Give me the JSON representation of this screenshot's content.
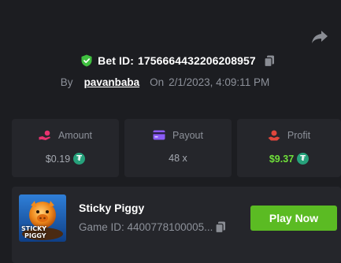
{
  "share": {
    "icon": "share-icon"
  },
  "bet": {
    "label": "Bet ID:",
    "id": "1756664432206208957",
    "by_label": "By",
    "username": "pavanbaba",
    "on_label": "On",
    "datetime": "2/1/2023, 4:09:11 PM"
  },
  "stats": {
    "amount": {
      "label": "Amount",
      "value": "$0.19",
      "icon": "hand-coin-icon",
      "icon_color": "#e8336f"
    },
    "payout": {
      "label": "Payout",
      "value": "48 x",
      "icon": "credit-card-icon",
      "icon_color": "#8b5cf6"
    },
    "profit": {
      "label": "Profit",
      "value": "$9.37",
      "icon": "money-hand-icon",
      "icon_color": "#e0463c"
    }
  },
  "currency": {
    "symbol": "₮",
    "color": "#26a17b"
  },
  "game": {
    "title": "Sticky Piggy",
    "id_text": "Game ID: 4400778100005...",
    "play_label": "Play Now",
    "thumb_text_line1": "STICKY",
    "thumb_text_line2": "PIGGY"
  },
  "colors": {
    "background": "#1c1d21",
    "card": "#25262b",
    "accent_green": "#5bbb23",
    "profit_green": "#6fe03a",
    "verified_green": "#3fbf3f"
  }
}
